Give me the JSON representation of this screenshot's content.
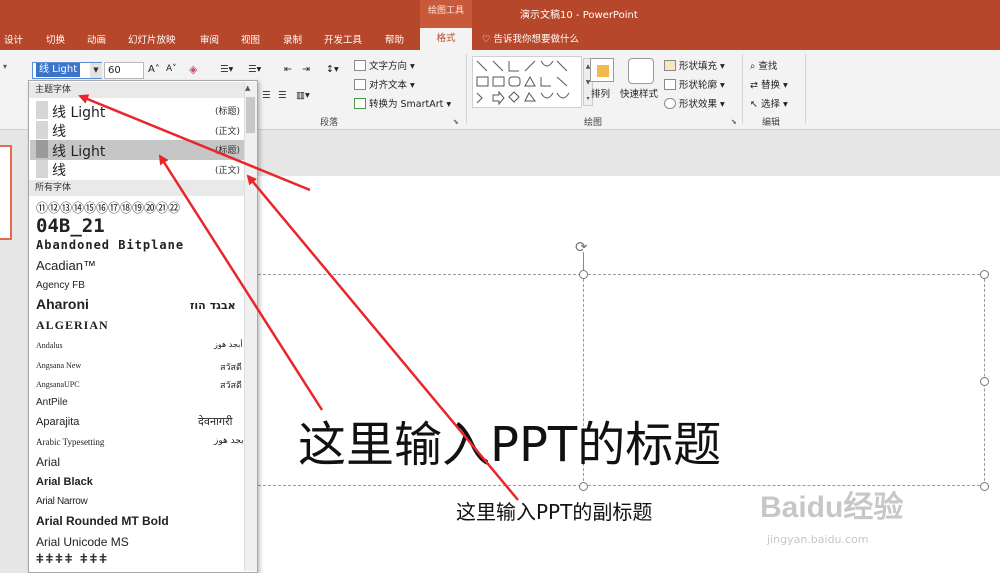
{
  "titlebar": {
    "context_tool": "绘图工具",
    "doc_title": "演示文稿10  -  PowerPoint"
  },
  "tabs": [
    "设计",
    "切换",
    "动画",
    "幻灯片放映",
    "审阅",
    "视图",
    "录制",
    "开发工具",
    "帮助"
  ],
  "active_tab": "格式",
  "tell_me": "告诉我你想要做什么",
  "font": {
    "current": "线 Light",
    "size": "60"
  },
  "ribbon": {
    "paragraph": {
      "text_direction": "文字方向",
      "align_text": "对齐文本",
      "smartart": "转换为 SmartArt",
      "label": "段落"
    },
    "drawing": {
      "arrange": "排列",
      "quick_styles": "快速样式",
      "shape_fill": "形状填充",
      "shape_outline": "形状轮廓",
      "shape_effects": "形状效果",
      "label": "绘图"
    },
    "editing": {
      "find": "查找",
      "replace": "替换",
      "select": "选择",
      "label": "编辑"
    }
  },
  "dropdown": {
    "theme_header": "主题字体",
    "theme_fonts": [
      {
        "name": "线 Light",
        "hint": "(标题)"
      },
      {
        "name": "线",
        "hint": "(正文)"
      },
      {
        "name": "线 Light",
        "hint": "(标题)"
      },
      {
        "name": "线",
        "hint": "(正文)"
      }
    ],
    "all_header": "所有字体",
    "all_fonts": [
      {
        "name": "⑪⑫⑬⑭⑮⑯⑰⑱⑲⑳㉑㉒",
        "sample": ""
      },
      {
        "name": "04B_21",
        "sample": ""
      },
      {
        "name": "Abandoned Bitplane",
        "sample": ""
      },
      {
        "name": "Acadian™",
        "sample": ""
      },
      {
        "name": "Agency FB",
        "sample": ""
      },
      {
        "name": "Aharoni",
        "sample": "אבגד הוז"
      },
      {
        "name": "ALGERIAN",
        "sample": ""
      },
      {
        "name": "Andalus",
        "sample": "أبجد هوز"
      },
      {
        "name": "Angsana New",
        "sample": "สวัสดี"
      },
      {
        "name": "AngsanaUPC",
        "sample": "สวัสดี"
      },
      {
        "name": "AntPile",
        "sample": ""
      },
      {
        "name": "Aparajita",
        "sample": "देवनागरी"
      },
      {
        "name": "Arabic Typesetting",
        "sample": "أبجد هوز"
      },
      {
        "name": "Arial",
        "sample": ""
      },
      {
        "name": "Arial Black",
        "sample": ""
      },
      {
        "name": "Arial Narrow",
        "sample": ""
      },
      {
        "name": "Arial Rounded MT Bold",
        "sample": ""
      },
      {
        "name": "Arial Unicode MS",
        "sample": ""
      }
    ]
  },
  "slide": {
    "title": "这里输入PPT的标题",
    "subtitle": "这里输入PPT的副标题"
  },
  "watermark": {
    "logo": "Baidu经验",
    "url": "jingyan.baidu.com"
  },
  "colors": {
    "accent": "#b7472a",
    "arrow": "#e8262b"
  }
}
